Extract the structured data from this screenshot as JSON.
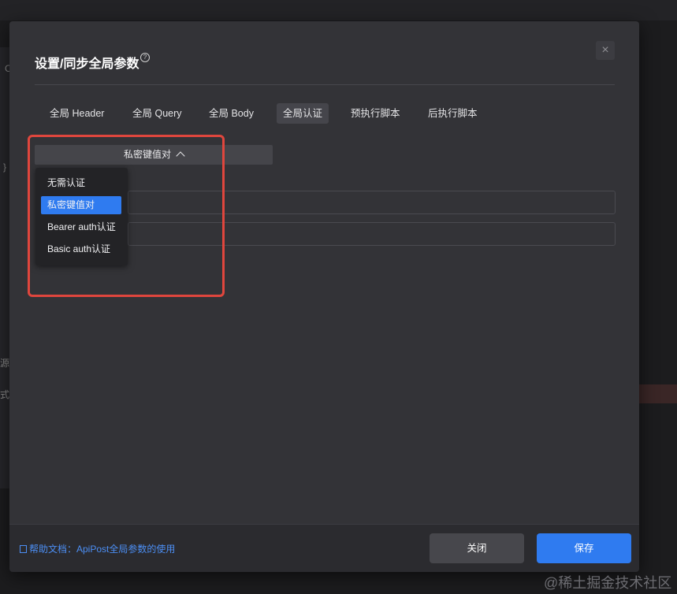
{
  "background": {
    "left_chars": [
      "C",
      "}",
      "源",
      "式"
    ]
  },
  "modal": {
    "title": "设置/同步全局参数",
    "close_label": "×",
    "tabs": [
      {
        "label": "全局 Header",
        "active": false
      },
      {
        "label": "全局 Query",
        "active": false
      },
      {
        "label": "全局 Body",
        "active": false
      },
      {
        "label": "全局认证",
        "active": true
      },
      {
        "label": "预执行脚本",
        "active": false
      },
      {
        "label": "后执行脚本",
        "active": false
      }
    ],
    "auth_type": {
      "selected": "私密键值对",
      "options": [
        "无需认证",
        "私密键值对",
        "Bearer auth认证",
        "Basic auth认证"
      ]
    },
    "footer": {
      "help_text": "帮助文档：ApiPost全局参数的使用",
      "close_button": "关闭",
      "save_button": "保存"
    }
  },
  "colors": {
    "accent": "#2f7bf0",
    "highlight": "#e0463d",
    "modal_bg": "#333337",
    "link": "#4c8ff5"
  },
  "icons": [
    "help-circle-icon",
    "close-icon",
    "chevron-up-icon",
    "document-icon"
  ],
  "watermark": "@稀土掘金技术社区"
}
